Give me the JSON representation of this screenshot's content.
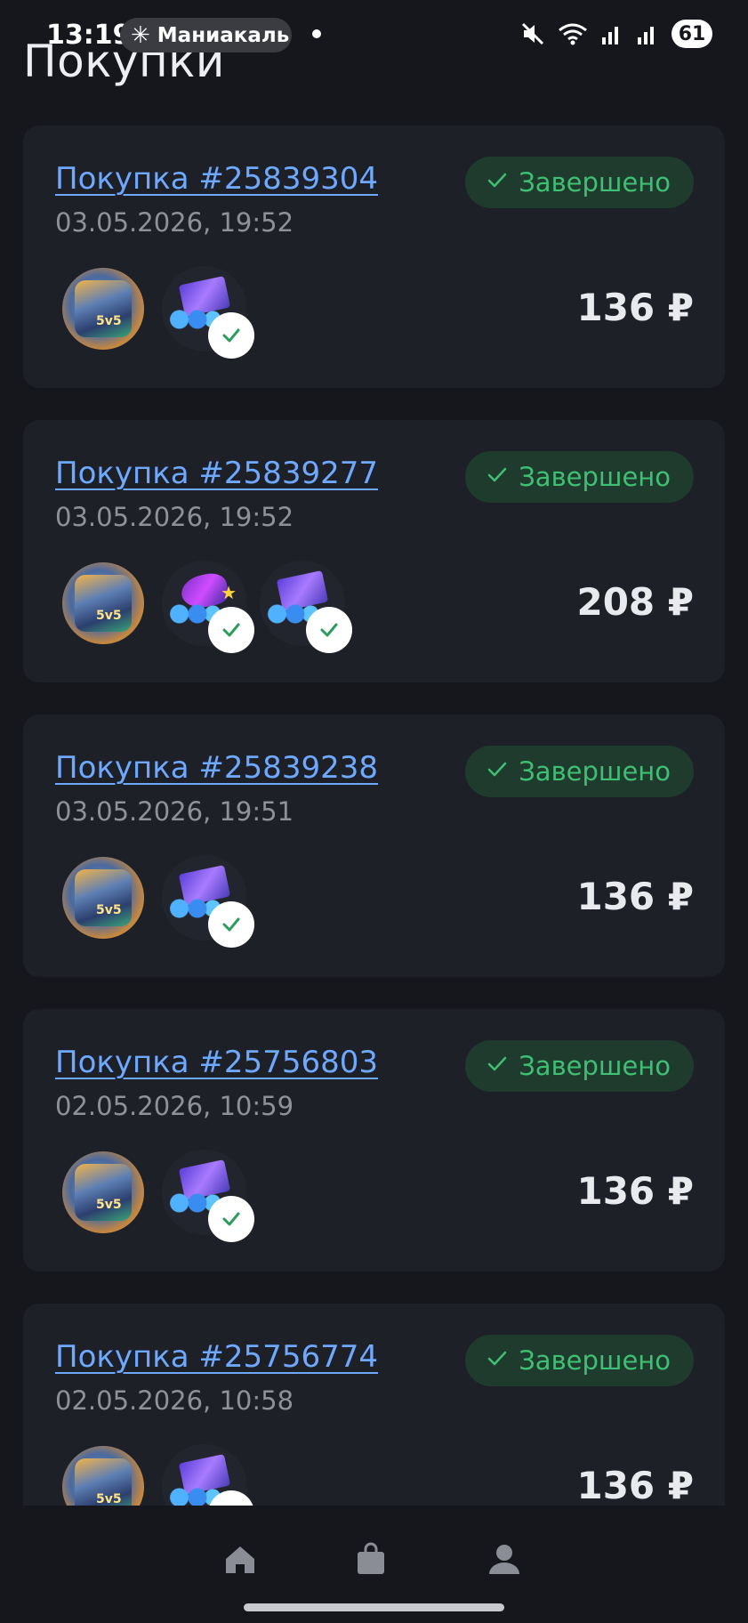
{
  "status_bar": {
    "time": "13:19",
    "notification_text": "Маниакаль",
    "battery": "61"
  },
  "page": {
    "title": "Покупки"
  },
  "orders": [
    {
      "title": "Покупка #25839304",
      "date": "03.05.2026, 19:52",
      "status": "Завершено",
      "price": "136 ₽",
      "products": [
        "diamonds"
      ]
    },
    {
      "title": "Покупка #25839277",
      "date": "03.05.2026, 19:52",
      "status": "Завершено",
      "price": "208 ₽",
      "products": [
        "starlight",
        "diamonds"
      ]
    },
    {
      "title": "Покупка #25839238",
      "date": "03.05.2026, 19:51",
      "status": "Завершено",
      "price": "136 ₽",
      "products": [
        "diamonds"
      ]
    },
    {
      "title": "Покупка #25756803",
      "date": "02.05.2026, 10:59",
      "status": "Завершено",
      "price": "136 ₽",
      "products": [
        "diamonds"
      ]
    },
    {
      "title": "Покупка #25756774",
      "date": "02.05.2026, 10:58",
      "status": "Завершено",
      "price": "136 ₽",
      "products": [
        "diamonds"
      ]
    }
  ],
  "game_icon_label": "5v5",
  "bottom_nav": {
    "items": [
      {
        "icon": "home-icon"
      },
      {
        "icon": "shopping-bag-icon"
      },
      {
        "icon": "profile-icon"
      }
    ]
  },
  "colors": {
    "background": "#15171d",
    "card": "#1e2028",
    "link": "#6ea8ff",
    "status_text": "#3fbf73",
    "status_bg": "#1f3b2d"
  }
}
